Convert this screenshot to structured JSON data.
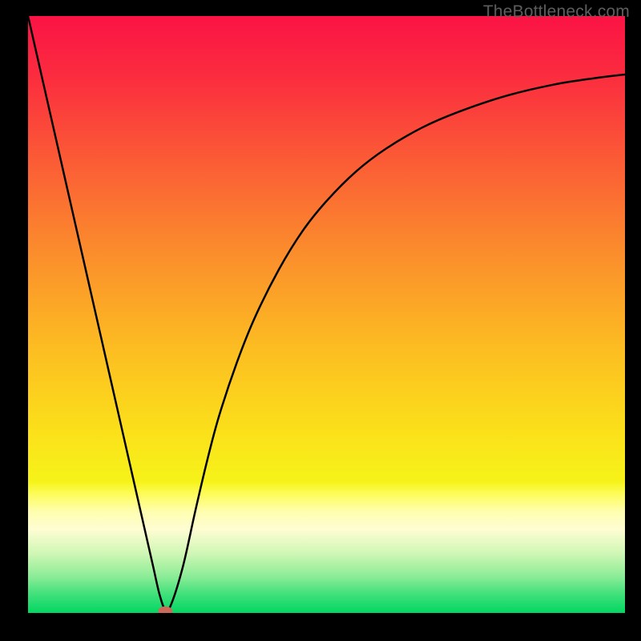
{
  "watermark": "TheBottleneck.com",
  "chart_data": {
    "type": "line",
    "title": "",
    "xlabel": "",
    "ylabel": "",
    "xlim": [
      0,
      100
    ],
    "ylim": [
      0,
      100
    ],
    "background_gradient": {
      "stops": [
        {
          "offset": 0.0,
          "color": "#fb1345"
        },
        {
          "offset": 0.1,
          "color": "#fb2c3f"
        },
        {
          "offset": 0.25,
          "color": "#fb5e35"
        },
        {
          "offset": 0.4,
          "color": "#fb8e2c"
        },
        {
          "offset": 0.55,
          "color": "#fcbb22"
        },
        {
          "offset": 0.7,
          "color": "#fbe11a"
        },
        {
          "offset": 0.78,
          "color": "#f6f319"
        },
        {
          "offset": 0.8,
          "color": "#fdfc58"
        },
        {
          "offset": 0.83,
          "color": "#fffeaf"
        },
        {
          "offset": 0.86,
          "color": "#fefdd3"
        },
        {
          "offset": 0.9,
          "color": "#d0f7b5"
        },
        {
          "offset": 0.94,
          "color": "#89ec96"
        },
        {
          "offset": 0.97,
          "color": "#3ce079"
        },
        {
          "offset": 1.0,
          "color": "#04d663"
        }
      ]
    },
    "series": [
      {
        "name": "bottleneck-curve",
        "color": "#000000",
        "x": [
          0,
          2,
          4,
          6,
          8,
          10,
          12,
          14,
          16,
          18,
          20,
          21,
          22,
          23,
          24,
          26,
          28,
          30,
          32,
          35,
          38,
          42,
          46,
          50,
          55,
          60,
          66,
          72,
          80,
          88,
          95,
          100
        ],
        "y": [
          100,
          91.2,
          82.4,
          73.6,
          64.8,
          56.0,
          47.2,
          38.4,
          29.6,
          20.8,
          12.0,
          7.6,
          3.2,
          0.5,
          1.5,
          8.0,
          17.0,
          25.5,
          33.0,
          42.0,
          49.5,
          57.5,
          64.0,
          69.0,
          74.0,
          77.8,
          81.3,
          83.9,
          86.6,
          88.5,
          89.6,
          90.2
        ]
      }
    ],
    "marker": {
      "name": "optimal-point",
      "x": 23,
      "y": 0.3,
      "color": "#cb6a5a",
      "rx": 9,
      "ry": 6
    }
  }
}
